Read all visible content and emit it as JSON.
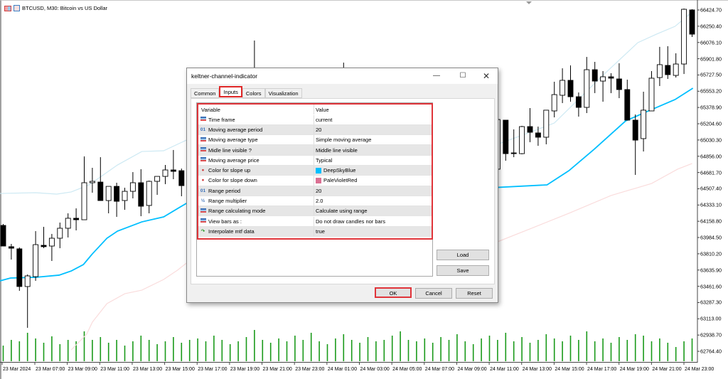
{
  "chart_header": {
    "title": "BTCUSD, M30:  Bitcoin vs US Dollar"
  },
  "price_axis": [
    "66424.70",
    "66250.40",
    "66076.10",
    "65901.80",
    "65727.50",
    "65553.20",
    "65378.90",
    "65204.60",
    "65030.30",
    "64856.00",
    "64681.70",
    "64507.40",
    "64333.10",
    "64158.80",
    "63984.50",
    "63810.20",
    "63635.90",
    "63461.60",
    "63287.30",
    "63113.00",
    "62938.70",
    "62764.40"
  ],
  "time_axis": [
    "23 Mar 2024",
    "23 Mar 07:00",
    "23 Mar 09:00",
    "23 Mar 11:00",
    "23 Mar 13:00",
    "23 Mar 15:00",
    "23 Mar 17:00",
    "23 Mar 19:00",
    "23 Mar 21:00",
    "23 Mar 23:00",
    "24 Mar 01:00",
    "24 Mar 03:00",
    "24 Mar 05:00",
    "24 Mar 07:00",
    "24 Mar 09:00",
    "24 Mar 11:00",
    "24 Mar 13:00",
    "24 Mar 15:00",
    "24 Mar 17:00",
    "24 Mar 19:00",
    "24 Mar 21:00",
    "24 Mar 23:00"
  ],
  "colors": {
    "bull": "#ffffff",
    "bear": "#000000",
    "middle": "#00bfff",
    "upper": "#cde9f3",
    "lower": "#fadcdc",
    "volume": "#1a9a1a",
    "slope_up": "#00bfff",
    "slope_down": "#db7093"
  },
  "chart_data": {
    "type": "candlestick",
    "symbol": "BTCUSD",
    "timeframe": "M30",
    "ylim": [
      62700,
      66500
    ],
    "candles": [
      [
        0,
        64114,
        64130,
        63893,
        63893
      ],
      [
        1,
        63886,
        63916,
        63748,
        63870
      ],
      [
        2,
        63863,
        63878,
        63413,
        63459
      ],
      [
        3,
        63459,
        63588,
        63016,
        63573
      ],
      [
        4,
        63565,
        64053,
        63520,
        63908
      ],
      [
        5,
        63901,
        64099,
        63870,
        63886
      ],
      [
        6,
        63893,
        64023,
        63733,
        63977
      ],
      [
        7,
        63977,
        64145,
        63870,
        64084
      ],
      [
        8,
        64084,
        64244,
        63985,
        64191
      ],
      [
        9,
        64191,
        64297,
        64061,
        64175
      ],
      [
        10,
        64175,
        64854,
        64175,
        64572
      ],
      [
        11,
        64572,
        64732,
        64465,
        64587
      ],
      [
        12,
        64579,
        64846,
        64381,
        64381
      ],
      [
        13,
        64381,
        64533,
        64244,
        64533
      ],
      [
        14,
        64533,
        64572,
        64206,
        64373
      ],
      [
        15,
        64381,
        64518,
        64282,
        64480
      ],
      [
        16,
        64480,
        64686,
        64404,
        64572
      ],
      [
        17,
        64572,
        64717,
        64213,
        64320
      ],
      [
        18,
        64328,
        64595,
        64244,
        64587
      ],
      [
        19,
        64587,
        64640,
        64442,
        64640
      ],
      [
        20,
        64640,
        64762,
        64557,
        64709
      ],
      [
        21,
        64709,
        64923,
        64610,
        64694
      ],
      [
        22,
        64701,
        64724,
        64427,
        64541
      ],
      [
        31,
        65500,
        66097,
        65300,
        65400
      ],
      [
        42,
        65450,
        65860,
        65300,
        65500
      ],
      [
        61,
        64717,
        65312,
        64717,
        65250
      ],
      [
        62,
        65243,
        65243,
        64808,
        64884
      ],
      [
        63,
        64892,
        65144,
        64846,
        64884
      ],
      [
        64,
        64884,
        65182,
        64877,
        65174
      ],
      [
        65,
        65174,
        65372,
        65006,
        65113
      ],
      [
        66,
        65106,
        65174,
        64968,
        65060
      ],
      [
        67,
        65060,
        65350,
        64984,
        65350
      ],
      [
        68,
        65342,
        65655,
        65273,
        65517
      ],
      [
        69,
        65510,
        65799,
        65426,
        65670
      ],
      [
        70,
        65670,
        65830,
        65441,
        65494
      ],
      [
        71,
        65494,
        65540,
        65281,
        65380
      ],
      [
        72,
        65380,
        65921,
        65319,
        65784
      ],
      [
        73,
        65784,
        65868,
        65533,
        65662
      ],
      [
        74,
        65662,
        65769,
        65441,
        65708
      ],
      [
        75,
        65708,
        65746,
        65533,
        65693
      ],
      [
        76,
        65685,
        65853,
        65479,
        65571
      ],
      [
        77,
        65571,
        65677,
        65243,
        65243
      ],
      [
        78,
        65243,
        65304,
        64656,
        65029
      ],
      [
        79,
        65045,
        65548,
        64907,
        65350
      ],
      [
        80,
        65342,
        65769,
        65342,
        65693
      ],
      [
        81,
        65700,
        66029,
        65609,
        65838
      ],
      [
        82,
        65830,
        66036,
        65685,
        65731
      ],
      [
        83,
        65723,
        65960,
        65700,
        65845
      ],
      [
        84,
        65845,
        66440,
        65738,
        66432
      ],
      [
        85,
        66425,
        66432,
        66135,
        66165
      ]
    ],
    "middle_line": [
      [
        -0.4,
        63520
      ],
      [
        0.9,
        63550
      ],
      [
        4,
        63558
      ],
      [
        6.9,
        63581
      ],
      [
        8.4,
        63626
      ],
      [
        9.9,
        63695
      ],
      [
        11,
        63809
      ],
      [
        12.8,
        63977
      ],
      [
        14.1,
        64053
      ],
      [
        17.1,
        64152
      ],
      [
        19.8,
        64206
      ],
      [
        22.6,
        64351
      ],
      [
        67.1,
        64549
      ],
      [
        69.8,
        64701
      ],
      [
        72.9,
        64930
      ],
      [
        76.8,
        65235
      ],
      [
        79.4,
        65334
      ],
      [
        82.9,
        65464
      ],
      [
        85.1,
        65586
      ]
    ],
    "upper_line": [
      [
        -0.4,
        64457
      ],
      [
        4,
        64465
      ],
      [
        6.6,
        64450
      ],
      [
        8.4,
        64473
      ],
      [
        10.6,
        64549
      ],
      [
        14.1,
        64762
      ],
      [
        17.1,
        64907
      ],
      [
        19.8,
        64915
      ],
      [
        22.6,
        65029
      ],
      [
        61.2,
        64991
      ],
      [
        64.1,
        65083
      ],
      [
        68,
        65212
      ],
      [
        73.9,
        65716
      ],
      [
        78.3,
        66074
      ],
      [
        80.6,
        66165
      ],
      [
        82.9,
        66249
      ],
      [
        85,
        66402
      ]
    ],
    "lower_line": [
      [
        8.4,
        62780
      ],
      [
        10.3,
        62948
      ],
      [
        11,
        63077
      ],
      [
        12.8,
        63276
      ],
      [
        15,
        63382
      ],
      [
        17.1,
        63420
      ],
      [
        19.8,
        63535
      ],
      [
        21.5,
        63634
      ],
      [
        22.6,
        63710
      ],
      [
        61,
        63939
      ],
      [
        65.4,
        64091
      ],
      [
        69.8,
        64244
      ],
      [
        75,
        64435
      ],
      [
        80,
        64564
      ],
      [
        83.2,
        64717
      ],
      [
        85,
        64778
      ]
    ],
    "volumes": [
      22,
      30,
      28,
      40,
      32,
      26,
      35,
      24,
      30,
      28,
      42,
      30,
      34,
      26,
      30,
      22,
      28,
      36,
      30,
      24,
      28,
      34,
      26,
      30,
      32,
      28,
      36,
      30,
      24,
      28,
      34,
      44,
      30,
      26,
      32,
      28,
      36,
      30,
      40,
      28,
      24,
      32,
      38,
      30,
      26,
      34,
      28,
      30,
      36,
      42,
      30,
      28,
      32,
      26,
      34,
      30,
      38,
      28,
      24,
      32,
      36,
      30,
      40,
      28,
      34,
      26,
      30,
      38,
      32,
      28,
      36,
      30,
      42,
      28,
      32,
      26,
      34,
      30,
      38,
      36,
      28,
      32,
      26,
      20,
      28,
      32
    ]
  },
  "dialog": {
    "title": "keltner-channel-indicator",
    "tabs": [
      "Common",
      "Inputs",
      "Colors",
      "Visualization"
    ],
    "active_tab": "Inputs",
    "columns": [
      "Variable",
      "Value"
    ],
    "rows": [
      {
        "icon": "enum",
        "name": "Time frame",
        "value": "current"
      },
      {
        "icon": "int",
        "icon_text": "01",
        "name": "Moving average period",
        "value": "20"
      },
      {
        "icon": "enum",
        "name": "Moving average type",
        "value": "Simple moving average"
      },
      {
        "icon": "enum",
        "name": "Midle line visible ?",
        "value": "Middle line visible"
      },
      {
        "icon": "enum",
        "name": "Moving average price",
        "value": "Typical"
      },
      {
        "icon": "color",
        "name": "Color for slope up",
        "value": "DeepSkyBlue",
        "swatch": "#00bfff"
      },
      {
        "icon": "color",
        "name": "Color for slope down",
        "value": "PaleVioletRed",
        "swatch": "#db7093"
      },
      {
        "icon": "int",
        "icon_text": "01",
        "name": "Range period",
        "value": "20"
      },
      {
        "icon": "double",
        "icon_text": "½",
        "name": "Range multiplier",
        "value": "2.0"
      },
      {
        "icon": "enum",
        "name": "Range calculating mode",
        "value": "Calculate using range"
      },
      {
        "icon": "enum",
        "name": "View bars as :",
        "value": "Do not draw candles nor bars"
      },
      {
        "icon": "bool",
        "name": "Interpolate mtf data",
        "value": "true"
      }
    ],
    "buttons": {
      "load": "Load",
      "save": "Save",
      "ok": "OK",
      "cancel": "Cancel",
      "reset": "Reset"
    }
  }
}
